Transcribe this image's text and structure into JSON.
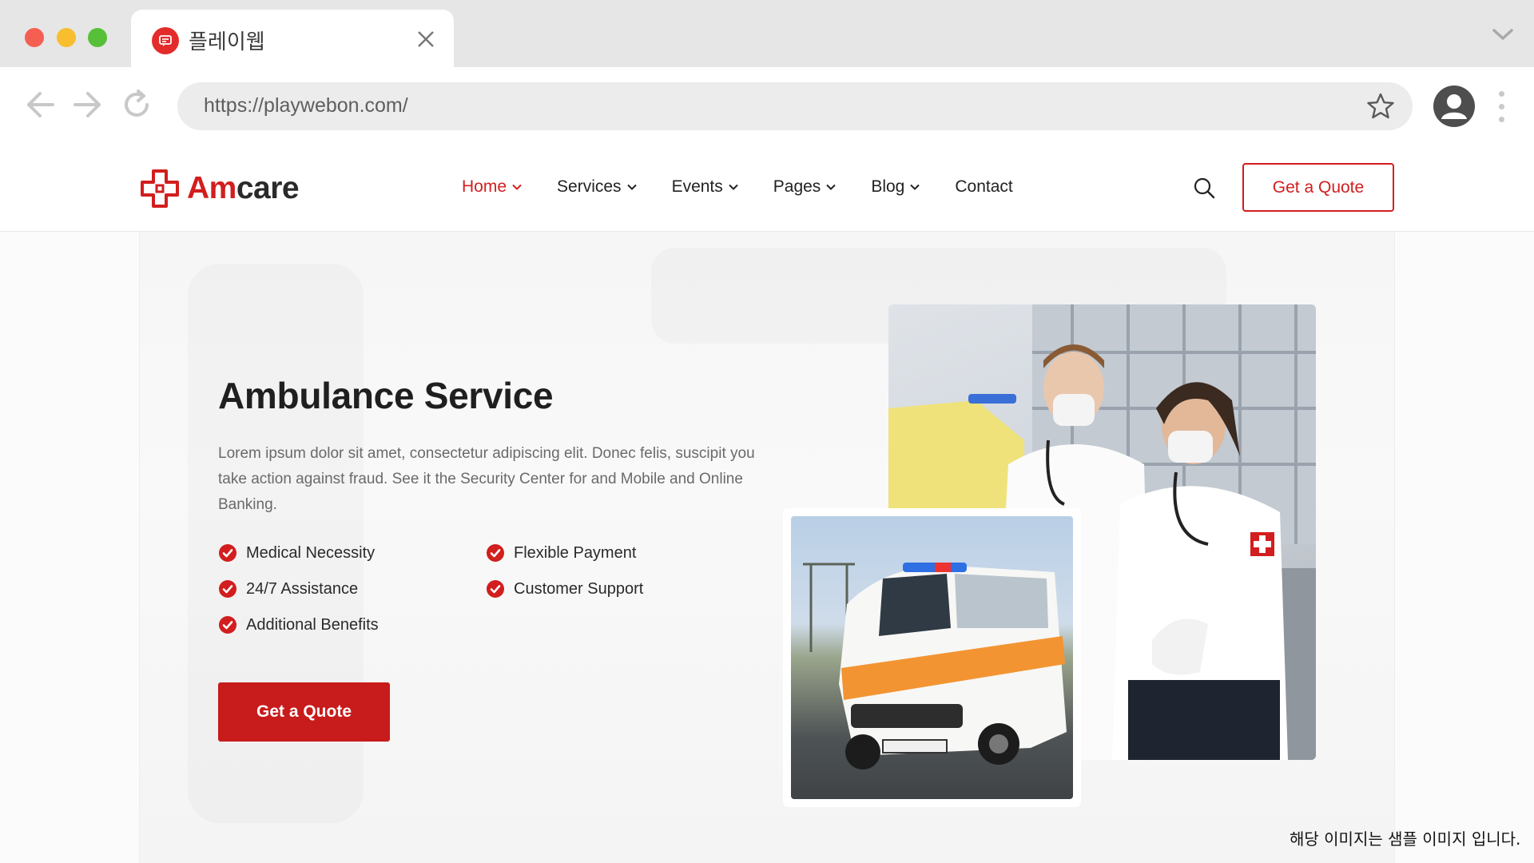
{
  "browser": {
    "tab_title": "플레이웹",
    "url": "https://playwebon.com/"
  },
  "site": {
    "logo": {
      "part1": "Am",
      "part2": "care"
    },
    "nav": [
      {
        "label": "Home",
        "dropdown": true,
        "active": true
      },
      {
        "label": "Services",
        "dropdown": true,
        "active": false
      },
      {
        "label": "Events",
        "dropdown": true,
        "active": false
      },
      {
        "label": "Pages",
        "dropdown": true,
        "active": false
      },
      {
        "label": "Blog",
        "dropdown": true,
        "active": false
      },
      {
        "label": "Contact",
        "dropdown": false,
        "active": false
      }
    ],
    "header_cta": "Get a Quote"
  },
  "hero": {
    "title": "Ambulance Service",
    "description": "Lorem ipsum dolor sit amet, consectetur adipiscing elit. Donec felis, suscipit you take action against fraud. See it the Security Center for and Mobile and Online Banking.",
    "features": [
      "Medical Necessity",
      "Flexible Payment",
      "24/7 Assistance",
      "Customer Support",
      "Additional Benefits"
    ],
    "cta": "Get a Quote",
    "photo_staff_name": "paramedics-photo",
    "photo_ambulance_name": "ambulance-photo"
  },
  "caption": "해당 이미지는 샘플 이미지 입니다.",
  "colors": {
    "brand_red": "#d21e1e",
    "button_red": "#c81b1b",
    "text_dark": "#1f1f1f",
    "text_muted": "#6a6a6a"
  }
}
